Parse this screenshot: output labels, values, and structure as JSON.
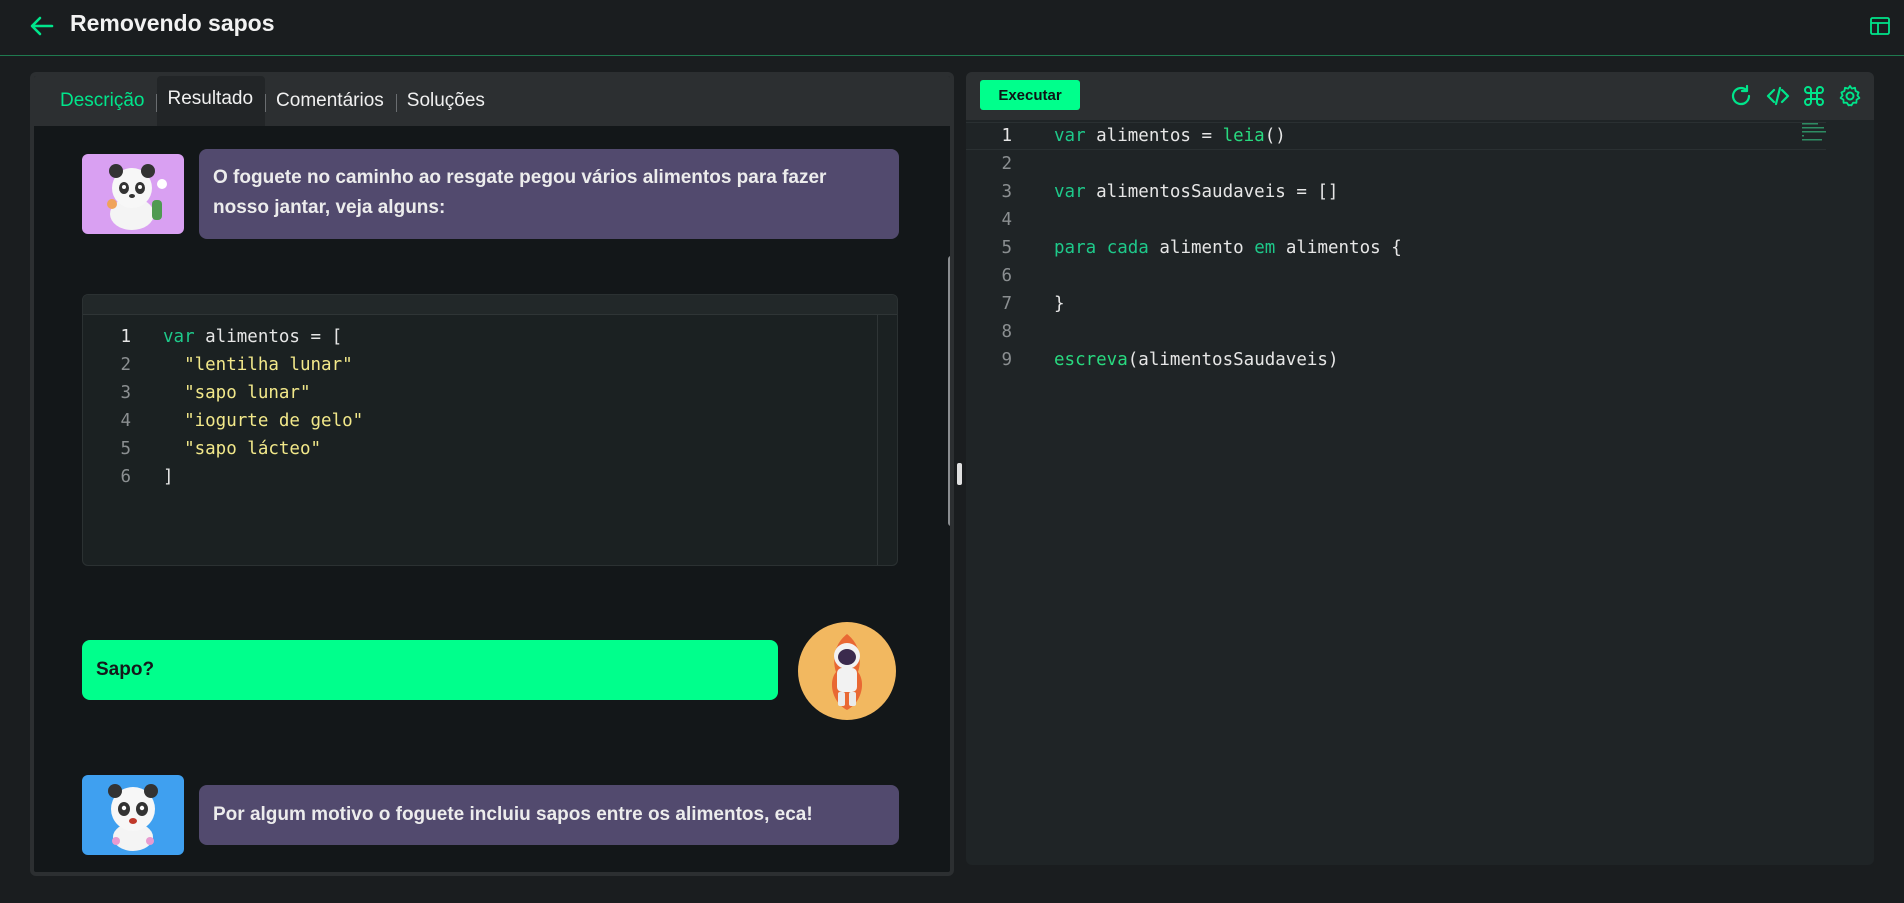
{
  "header": {
    "title": "Removendo sapos",
    "back_icon": "arrow-left-icon",
    "layout_icon": "layout-panel-icon",
    "accent": "#00e58b"
  },
  "tabs": [
    {
      "label": "Descrição",
      "active": true
    },
    {
      "label": "Resultado",
      "active": false
    },
    {
      "label": "Comentários",
      "active": false
    },
    {
      "label": "Soluções",
      "active": false
    }
  ],
  "messages": [
    {
      "speaker": "panda",
      "text": "O foguete no caminho ao resgate pegou vários alimentos para fazer nosso jantar, veja alguns:"
    },
    {
      "speaker": "astronaut",
      "text": "Sapo?"
    },
    {
      "speaker": "panda",
      "text": "Por algum motivo o foguete incluiu sapos entre os alimentos, eca!"
    }
  ],
  "example_code": {
    "lines": [
      "1",
      "2",
      "3",
      "4",
      "5",
      "6"
    ],
    "line1_kw": "var",
    "line1_rest": " alimentos = [",
    "items": [
      "\"lentilha lunar\"",
      "\"sapo lunar\"",
      "\"iogurte de gelo\"",
      "\"sapo lácteo\""
    ],
    "closing": "]"
  },
  "editor": {
    "run_label": "Executar",
    "tools": [
      "refresh-icon",
      "code-icon",
      "command-icon",
      "settings-icon"
    ],
    "line_numbers": [
      "1",
      "2",
      "3",
      "4",
      "5",
      "6",
      "7",
      "8",
      "9"
    ],
    "l1_kw": "var",
    "l1_mid": " alimentos = ",
    "l1_fn": "leia",
    "l1_end": "()",
    "l3_kw": "var",
    "l3_rest": " alimentosSaudaveis = []",
    "l5_kw1": "para",
    "l5_kw2": "cada",
    "l5_mid": " alimento ",
    "l5_kw3": "em",
    "l5_end": " alimentos {",
    "l7": "}",
    "l9_fn": "escreva",
    "l9_rest": "(alimentosSaudaveis)"
  }
}
